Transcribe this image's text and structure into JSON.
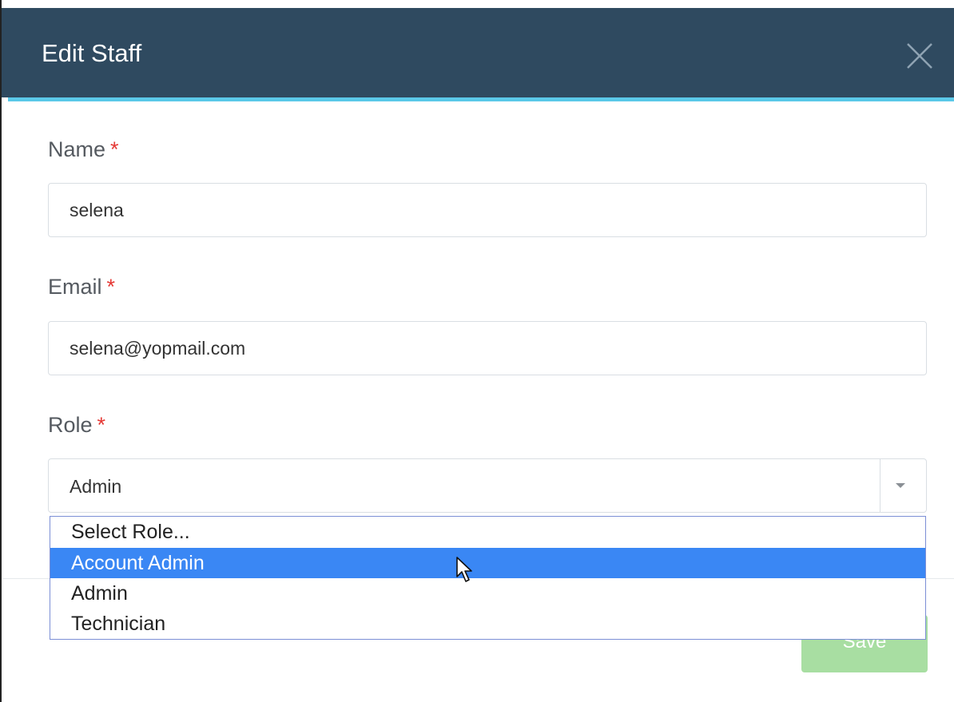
{
  "modal": {
    "title": "Edit Staff",
    "close_icon": "close-icon"
  },
  "form": {
    "name_label": "Name",
    "name_value": "selena",
    "email_label": "Email",
    "email_value": "selena@yopmail.com",
    "role_label": "Role",
    "role_value": "Admin",
    "required_marker": "*"
  },
  "dropdown": {
    "options": [
      {
        "label": "Select Role...",
        "selected": false
      },
      {
        "label": "Account Admin",
        "selected": true
      },
      {
        "label": "Admin",
        "selected": false
      },
      {
        "label": "Technician",
        "selected": false
      }
    ]
  },
  "footer": {
    "save_label": "Save"
  },
  "colors": {
    "header_bg": "#2f4a60",
    "accent": "#5ac8e8",
    "required": "#e53935",
    "highlight": "#3a87f4",
    "save_bg": "#a8dea2"
  }
}
